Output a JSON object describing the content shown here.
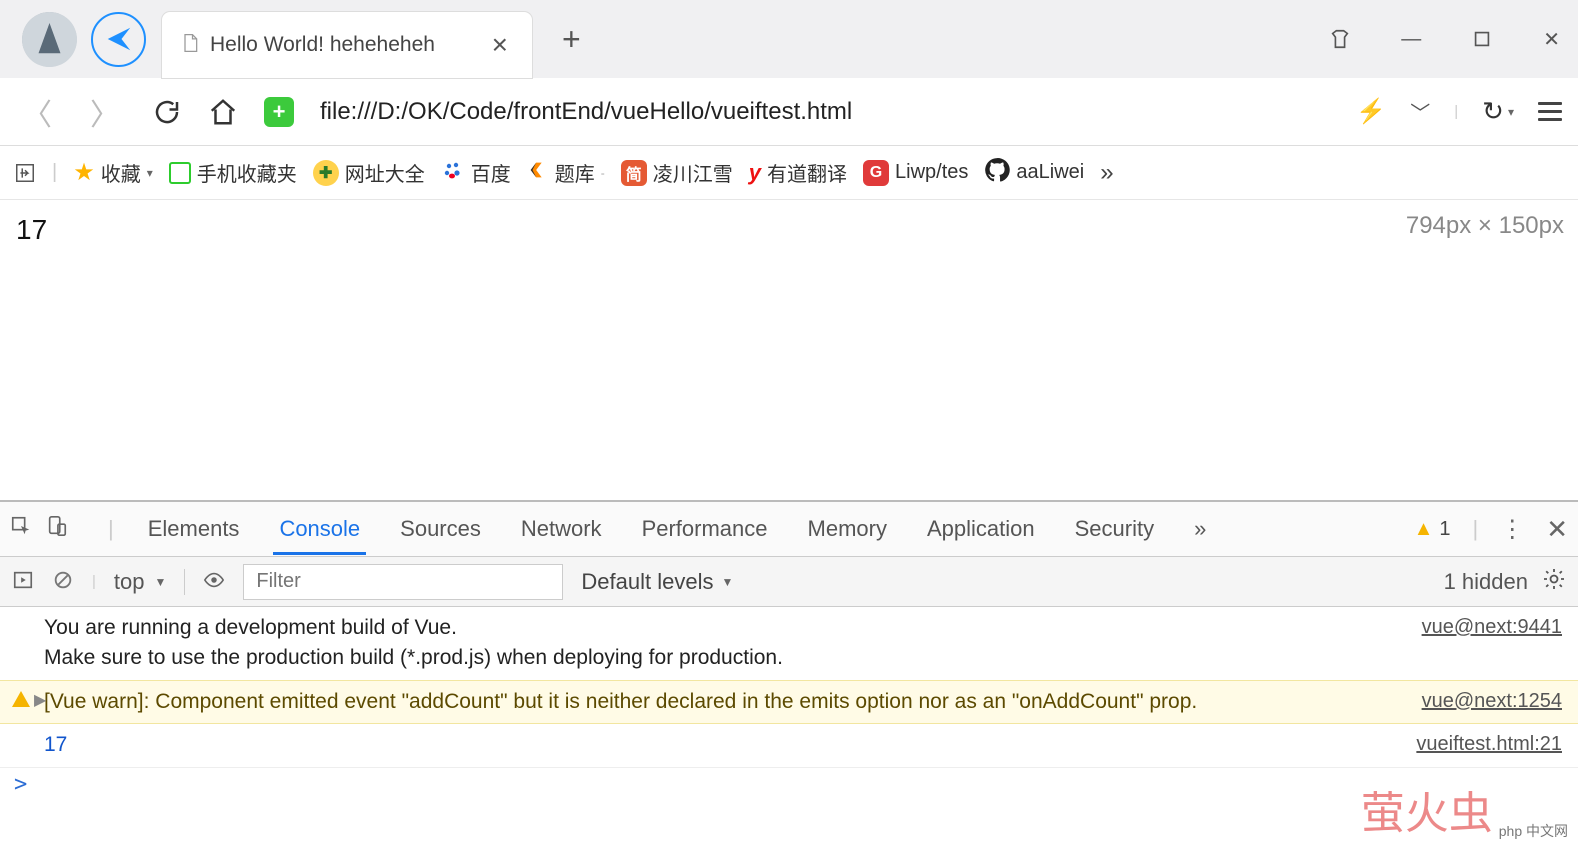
{
  "browser": {
    "tab_title": "Hello World! heheheheh",
    "url": "file:///D:/OK/Code/frontEnd/vueHello/vueiftest.html"
  },
  "bookmarks": {
    "fav": "收藏",
    "mobile_fav": "手机收藏夹",
    "site_daquan": "网址大全",
    "baidu": "百度",
    "tiku": "题库",
    "lingchuan": "凌川江雪",
    "youdao": "有道翻译",
    "liwp": "Liwp/tes",
    "aaliwei": "aaLiwei"
  },
  "page": {
    "counter": "17",
    "dimensions": "794px × 150px"
  },
  "devtools": {
    "tabs": {
      "elements": "Elements",
      "console": "Console",
      "sources": "Sources",
      "network": "Network",
      "performance": "Performance",
      "memory": "Memory",
      "application": "Application",
      "security": "Security"
    },
    "warn_count": "1",
    "context": "top",
    "filter_placeholder": "Filter",
    "levels": "Default levels",
    "hidden": "1 hidden",
    "messages": {
      "info_line1": "You are running a development build of Vue.",
      "info_line2": "Make sure to use the production build (*.prod.js) when deploying for production.",
      "info_src": "vue@next:9441",
      "warn_text": "[Vue warn]: Component emitted event \"addCount\" but it is neither declared in the emits option nor as an \"onAddCount\" prop.",
      "warn_src": "vue@next:1254",
      "log_val": "17",
      "log_src": "vueiftest.html:21"
    },
    "prompt": ">"
  },
  "watermark": {
    "main": "萤火虫",
    "sub": "php 中文网"
  }
}
